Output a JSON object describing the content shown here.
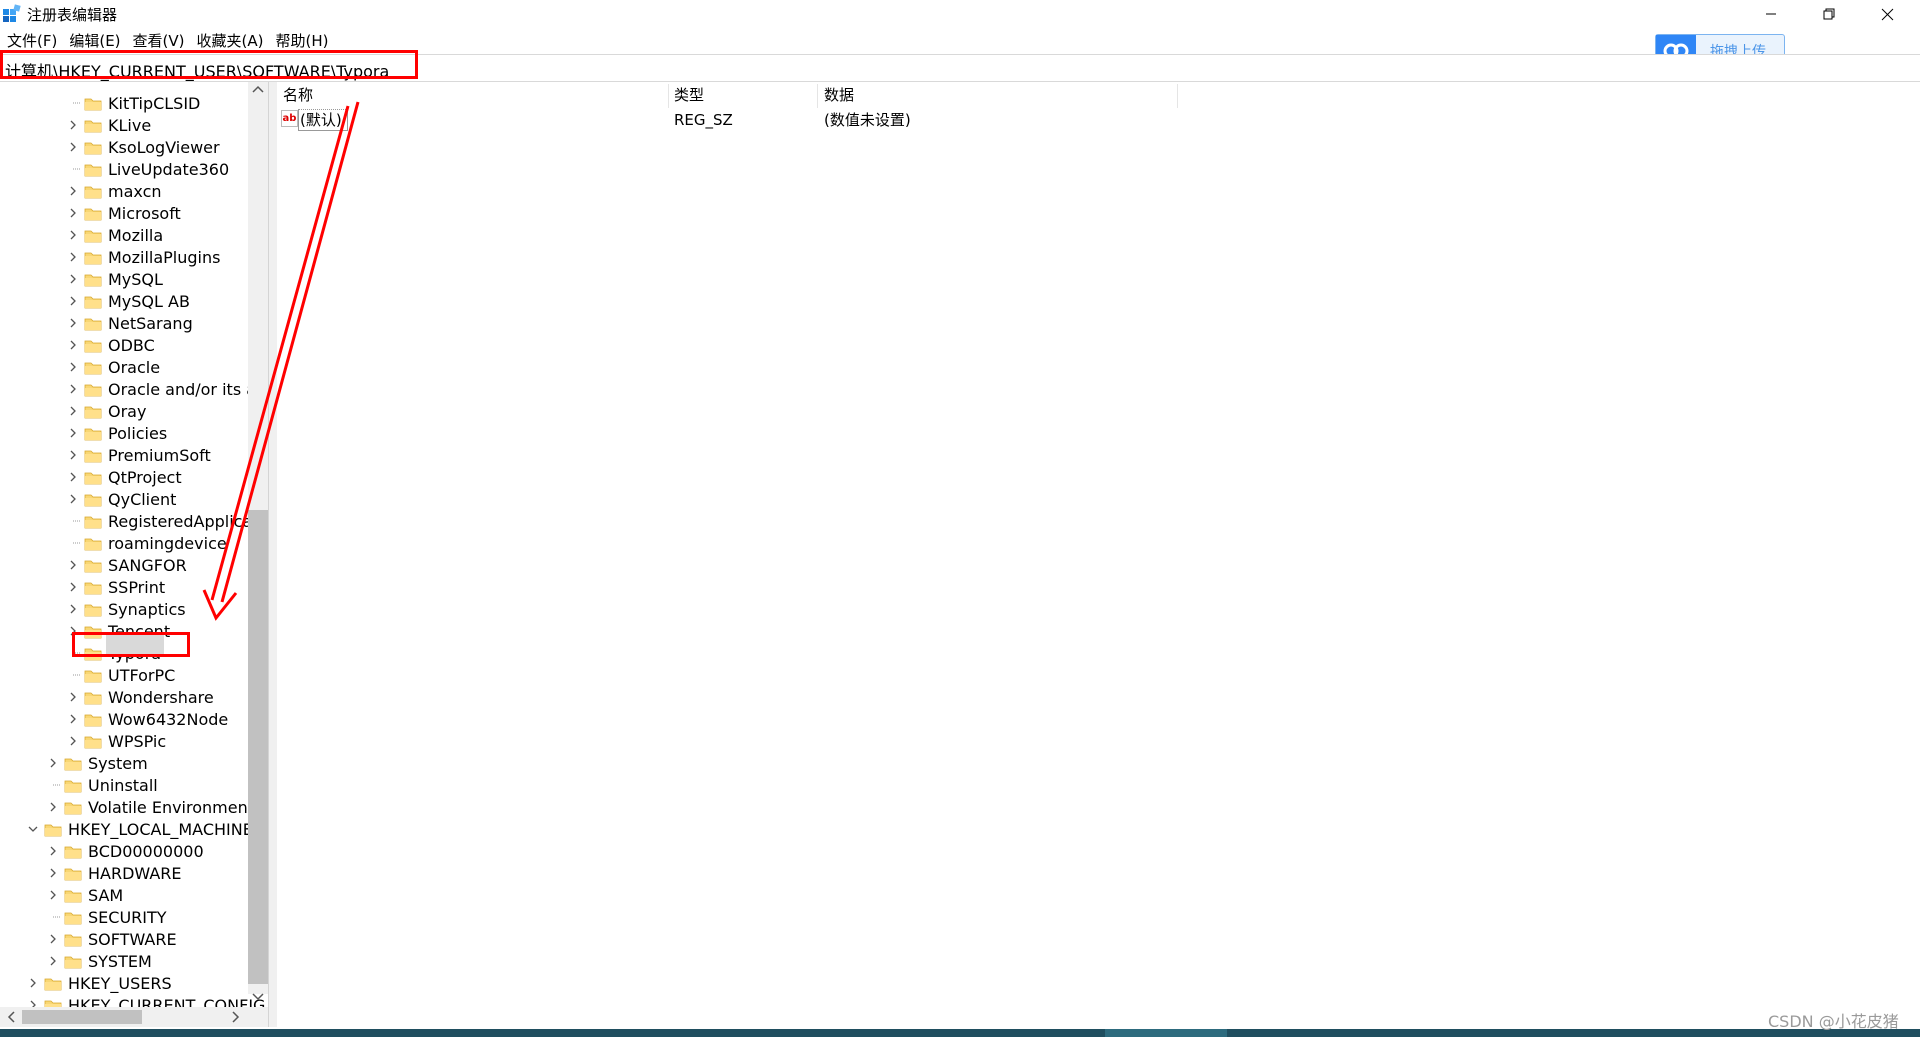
{
  "window": {
    "title": "注册表编辑器",
    "minimize_icon": "minimize-icon",
    "restore_icon": "restore-icon",
    "close_icon": "close-icon"
  },
  "menu": [
    "文件(F)",
    "编辑(E)",
    "查看(V)",
    "收藏夹(A)",
    "帮助(H)"
  ],
  "address": {
    "path": "计算机\\HKEY_CURRENT_USER\\SOFTWARE\\Typora",
    "highlight_color": "#ff0000"
  },
  "upload_button": {
    "label": "拖拽上传",
    "accent": "#2f86f6"
  },
  "tree": {
    "items": [
      {
        "label": "KitTipCLSID",
        "expandable": false
      },
      {
        "label": "KLive",
        "expandable": true
      },
      {
        "label": "KsoLogViewer",
        "expandable": true
      },
      {
        "label": "LiveUpdate360",
        "expandable": false
      },
      {
        "label": "maxcn",
        "expandable": true
      },
      {
        "label": "Microsoft",
        "expandable": true
      },
      {
        "label": "Mozilla",
        "expandable": true
      },
      {
        "label": "MozillaPlugins",
        "expandable": true
      },
      {
        "label": "MySQL",
        "expandable": true
      },
      {
        "label": "MySQL AB",
        "expandable": true
      },
      {
        "label": "NetSarang",
        "expandable": true
      },
      {
        "label": "ODBC",
        "expandable": true
      },
      {
        "label": "Oracle",
        "expandable": true
      },
      {
        "label": "Oracle and/or its af",
        "expandable": true
      },
      {
        "label": "Oray",
        "expandable": true
      },
      {
        "label": "Policies",
        "expandable": true
      },
      {
        "label": "PremiumSoft",
        "expandable": true
      },
      {
        "label": "QtProject",
        "expandable": true
      },
      {
        "label": "QyClient",
        "expandable": true
      },
      {
        "label": "RegisteredApplica",
        "expandable": false
      },
      {
        "label": "roamingdevice",
        "expandable": false
      },
      {
        "label": "SANGFOR",
        "expandable": true
      },
      {
        "label": "SSPrint",
        "expandable": true
      },
      {
        "label": "Synaptics",
        "expandable": true
      },
      {
        "label": "Tencent",
        "expandable": true
      },
      {
        "label": "Typora",
        "expandable": false,
        "selected": true
      },
      {
        "label": "UTForPC",
        "expandable": false
      },
      {
        "label": "Wondershare",
        "expandable": true
      },
      {
        "label": "Wow6432Node",
        "expandable": true
      },
      {
        "label": "WPSPic",
        "expandable": true
      },
      {
        "label": "System",
        "expandable": true
      },
      {
        "label": "Uninstall",
        "expandable": false
      },
      {
        "label": "Volatile Environment",
        "expandable": true
      },
      {
        "label": "HKEY_LOCAL_MACHINE",
        "expandable": true,
        "expanded": true
      },
      {
        "label": "BCD00000000",
        "expandable": true
      },
      {
        "label": "HARDWARE",
        "expandable": true
      },
      {
        "label": "SAM",
        "expandable": true
      },
      {
        "label": "SECURITY",
        "expandable": false
      },
      {
        "label": "SOFTWARE",
        "expandable": true
      },
      {
        "label": "SYSTEM",
        "expandable": true
      },
      {
        "label": "HKEY_USERS",
        "expandable": true
      },
      {
        "label": "HKEY_CURRENT_CONFIG",
        "expandable": true
      }
    ]
  },
  "list": {
    "columns": [
      "名称",
      "类型",
      "数据"
    ],
    "rows": [
      {
        "name": "(默认)",
        "type": "REG_SZ",
        "data": "(数值未设置)",
        "icon": "string-value-icon"
      }
    ]
  },
  "annotation": {
    "arrow_color": "#ff0000"
  },
  "watermark": "CSDN @小花皮猪"
}
